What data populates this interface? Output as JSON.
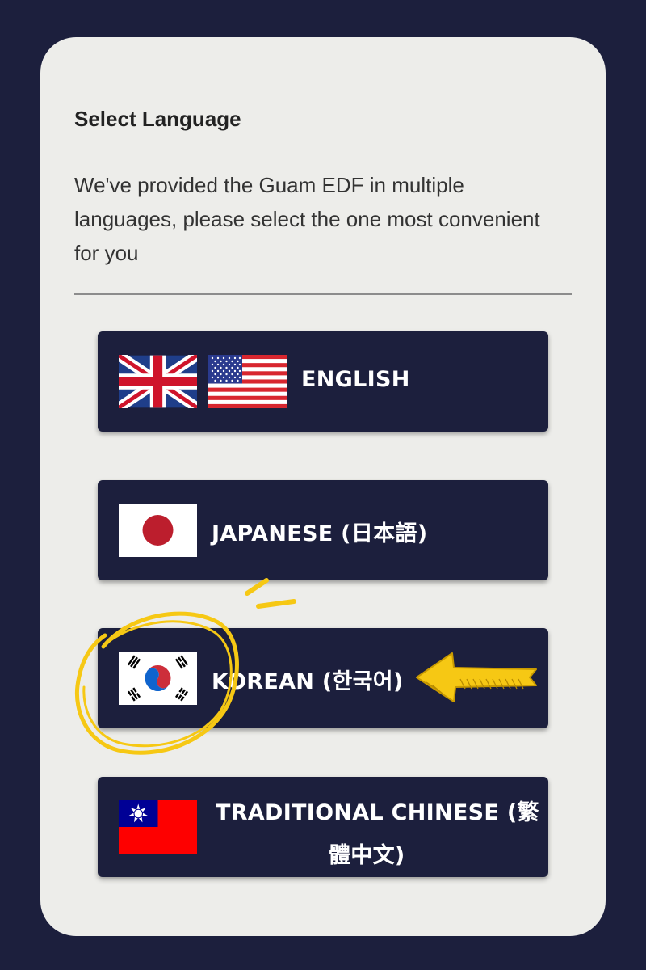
{
  "header": {
    "title": "Select Language",
    "description": "We've provided the Guam EDF in multiple languages, please select the one most convenient for you"
  },
  "languages": [
    {
      "label": "ENGLISH",
      "flags": [
        "uk-flag-icon",
        "us-flag-icon"
      ]
    },
    {
      "label": "JAPANESE (日本語)",
      "flags": [
        "japan-flag-icon"
      ]
    },
    {
      "label": "KOREAN (한국어)",
      "flags": [
        "south-korea-flag-icon"
      ]
    },
    {
      "label_line1": "TRADITIONAL CHINESE (繁",
      "label_line2": "體中文)",
      "flags": [
        "taiwan-flag-icon"
      ]
    }
  ],
  "annotations": {
    "highlight": "yellow-circle-around-korean-flag",
    "pointer": "yellow-arrow-pointing-to-korean"
  },
  "colors": {
    "background": "#1c1f3d",
    "card": "#ededea",
    "button": "#1c1f3d",
    "annotation": "#f6c814"
  }
}
